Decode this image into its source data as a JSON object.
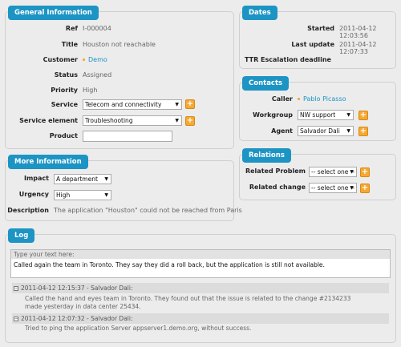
{
  "general": {
    "title": "General Information",
    "ref_label": "Ref",
    "ref_value": "I-000004",
    "title_label": "Title",
    "title_value": "Houston not reachable",
    "customer_label": "Customer",
    "customer_value": "Demo",
    "status_label": "Status",
    "status_value": "Assigned",
    "priority_label": "Priority",
    "priority_value": "High",
    "service_label": "Service",
    "service_value": "Telecom and connectivity",
    "service_element_label": "Service element",
    "service_element_value": "Troubleshooting",
    "product_label": "Product",
    "product_value": ""
  },
  "dates": {
    "title": "Dates",
    "started_label": "Started",
    "started_value": "2011-04-12 12:03:56",
    "last_update_label": "Last update",
    "last_update_value": "2011-04-12 12:07:33",
    "ttr_label": "TTR Escalation deadline"
  },
  "contacts": {
    "title": "Contacts",
    "caller_label": "Caller",
    "caller_value": "Pablo Picasso",
    "workgroup_label": "Workgroup",
    "workgroup_value": "NW support",
    "agent_label": "Agent",
    "agent_value": "Salvador Dali"
  },
  "more": {
    "title": "More Information",
    "impact_label": "Impact",
    "impact_value": "A department",
    "urgency_label": "Urgency",
    "urgency_value": "High",
    "description_label": "Description",
    "description_value": "The application \"Houston\" could not be reached from Paris"
  },
  "relations": {
    "title": "Relations",
    "problem_label": "Related Problem",
    "problem_value": "-- select one --",
    "change_label": "Related change",
    "change_value": "-- select one --"
  },
  "log": {
    "title": "Log",
    "input_placeholder": "Type your text here:",
    "input_text": "Called again the team in Toronto. They say they did a roll back, but the application is still not available.",
    "entries": [
      {
        "header": "2011-04-12 12:15:37 - Salvador Dali:",
        "line1": "Called the hand and eyes team in Toronto. They found out that the issue is related to the change #2134233",
        "line2": "made yesterday in data center 25434."
      },
      {
        "header": "2011-04-12 12:07:32 - Salvador Dali:",
        "line1": "Tried to ping the application Server appserver1.demo.org, without success.",
        "line2": ""
      }
    ]
  },
  "colors": {
    "accent": "#1c94c4",
    "plus": "#f7a833"
  }
}
